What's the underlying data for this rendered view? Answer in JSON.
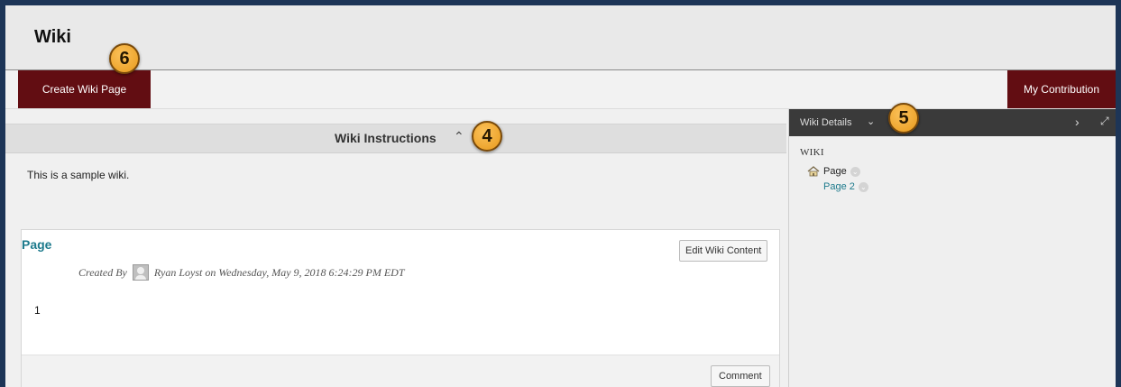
{
  "header": {
    "title": "Wiki"
  },
  "actions": {
    "create_label": "Create Wiki Page",
    "contribution_label": "My Contribution"
  },
  "instructions": {
    "title": "Wiki Instructions",
    "text": "This is a sample wiki."
  },
  "page": {
    "title": "Page",
    "edit_label": "Edit Wiki Content",
    "created_prefix": "Created By",
    "created_text": "Ryan Loyst on Wednesday, May 9, 2018 6:24:29 PM EDT",
    "content": "1",
    "comment_label": "Comment"
  },
  "sidebar": {
    "title": "Wiki Details",
    "section_label": "WIKI",
    "items": [
      {
        "label": "Page",
        "icon": "home-icon",
        "color": "#222222"
      },
      {
        "label": "Page 2",
        "icon": "",
        "color": "#1d7a8c"
      }
    ]
  },
  "callouts": [
    "6",
    "4",
    "5"
  ],
  "colors": {
    "brand": "#620d12",
    "frame": "#1d3557",
    "link": "#1d7a8c",
    "callout": "#f0a428"
  }
}
